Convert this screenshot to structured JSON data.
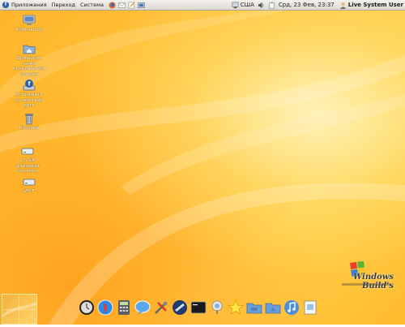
{
  "panel": {
    "menus": [
      "Приложения",
      "Переход",
      "Система"
    ],
    "keyboard_layout": "США",
    "datetime": "Срд, 23 Фев, 23:37",
    "user": "Live System User"
  },
  "desktop_icons": [
    {
      "label": "Компьютер",
      "icon": "computer-icon"
    },
    {
      "label": "Домашняя папка пользователя liveuser",
      "icon": "home-folder-icon"
    },
    {
      "label": "Установить на жёсткий диск",
      "icon": "install-icon"
    },
    {
      "label": "Корзина",
      "icon": "trash-icon"
    },
    {
      "label": "1,5 GB файловая система",
      "icon": "drive-icon"
    },
    {
      "label": "VM F",
      "icon": "drive-icon"
    }
  ],
  "dock_items": [
    "clock-icon",
    "safari-icon",
    "calculator-icon",
    "ichat-icon",
    "tools-icon",
    "telescope-icon",
    "terminal-icon",
    "finder-icon",
    "star-icon",
    "folder-icon",
    "folder-icon",
    "itunes-icon",
    "preview-icon"
  ],
  "logo": {
    "line1": "Windows Build's"
  },
  "colors": {
    "accent": "#ffb52a",
    "panel": "#e8e5df"
  }
}
